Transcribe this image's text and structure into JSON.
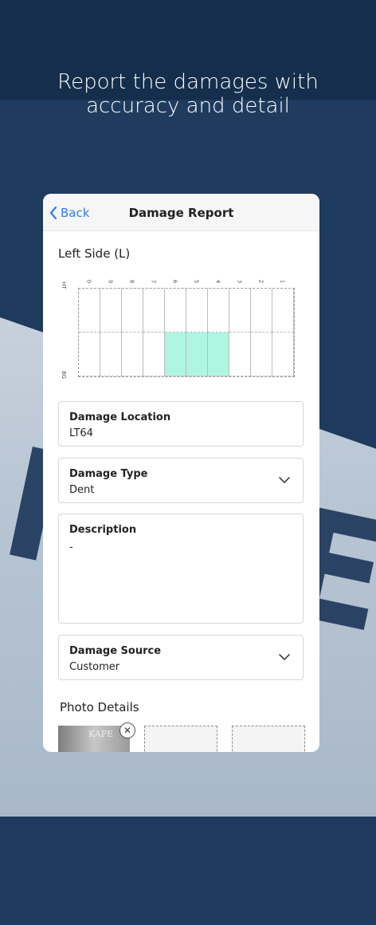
{
  "headline": {
    "line1": "Report the damages with",
    "line2": "accuracy and detail"
  },
  "navbar": {
    "back_label": "Back",
    "title": "Damage Report"
  },
  "diagram": {
    "section_title": "Left Side (L)",
    "row_labels": [
      "HT",
      "BG"
    ],
    "column_labels": [
      "0",
      "9",
      "8",
      "7",
      "6",
      "5",
      "4",
      "3",
      "2",
      "1"
    ],
    "highlighted_cells": [
      [
        1,
        4
      ],
      [
        1,
        5
      ],
      [
        1,
        6
      ]
    ],
    "highlight_color": "#aef5e2"
  },
  "fields": {
    "damage_location": {
      "label": "Damage Location",
      "value": "LT64"
    },
    "damage_type": {
      "label": "Damage Type",
      "value": "Dent"
    },
    "description": {
      "label": "Description",
      "value": "-"
    },
    "damage_source": {
      "label": "Damage Source",
      "value": "Customer"
    }
  },
  "photos": {
    "title": "Photo Details",
    "thumb_text": "KAPE"
  },
  "colors": {
    "accent": "#2f7df6",
    "background": "#1e3a5c"
  }
}
